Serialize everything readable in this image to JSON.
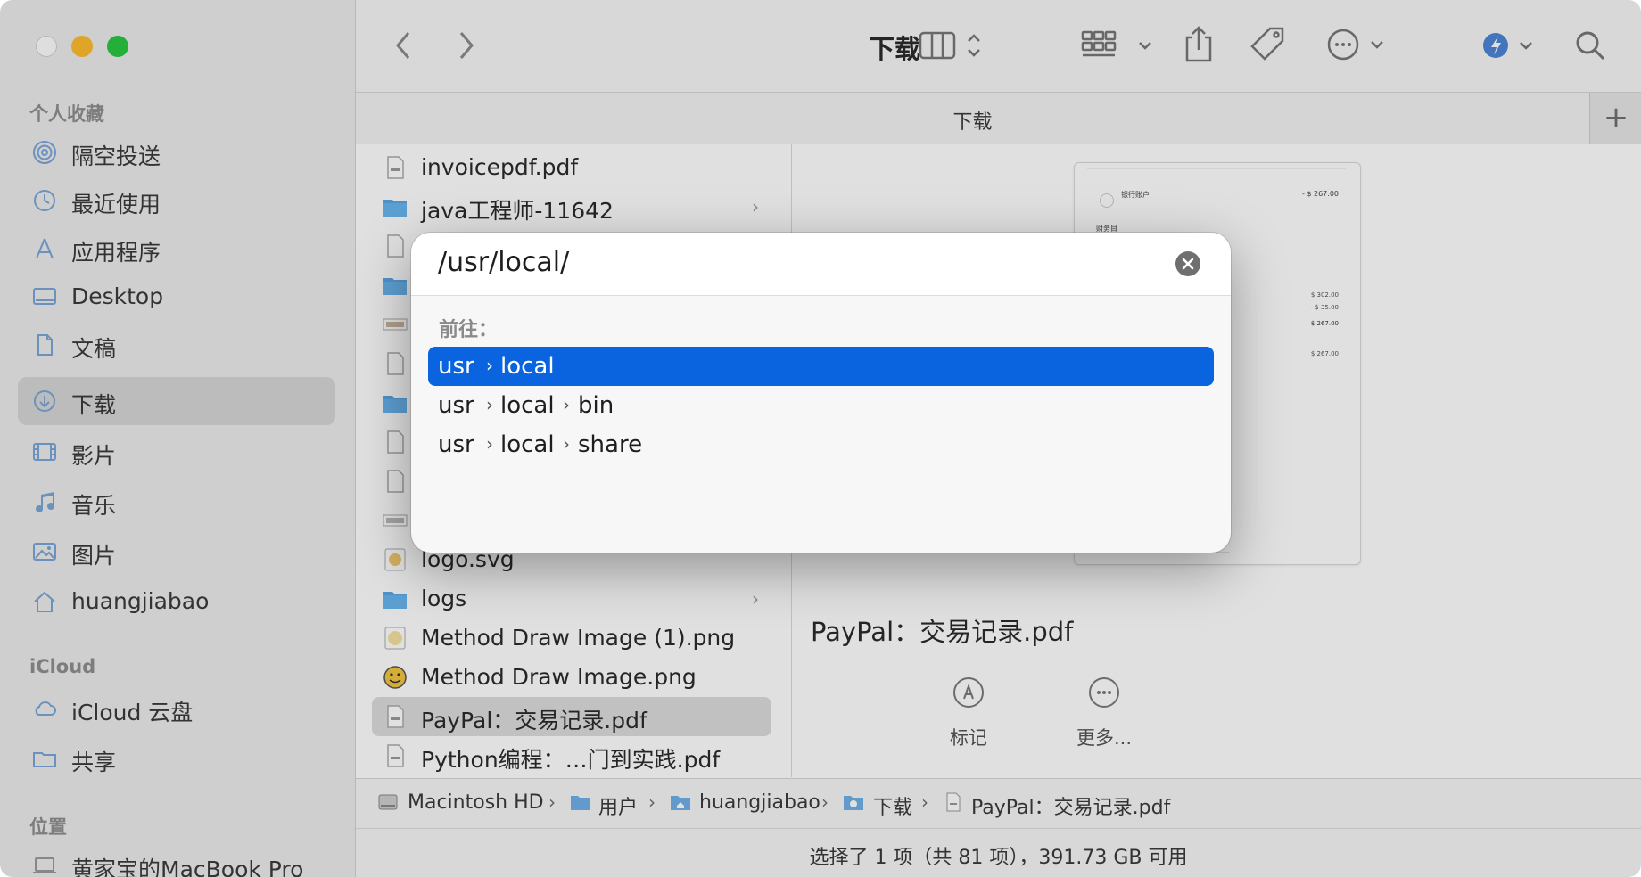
{
  "window": {
    "title": "下载",
    "tab_label": "下载",
    "tab_add": "+"
  },
  "sidebar": {
    "sections": [
      {
        "heading": "个人收藏"
      },
      {
        "heading": "iCloud"
      },
      {
        "heading": "位置"
      }
    ],
    "favorites": [
      {
        "label": "隔空投送",
        "icon": "airdrop-icon"
      },
      {
        "label": "最近使用",
        "icon": "clock-icon"
      },
      {
        "label": "应用程序",
        "icon": "apps-icon"
      },
      {
        "label": "Desktop",
        "icon": "desktop-icon"
      },
      {
        "label": "文稿",
        "icon": "document-icon"
      },
      {
        "label": "下载",
        "icon": "download-icon",
        "selected": true
      },
      {
        "label": "影片",
        "icon": "film-icon"
      },
      {
        "label": "音乐",
        "icon": "music-icon"
      },
      {
        "label": "图片",
        "icon": "photo-icon"
      },
      {
        "label": "huangjiabao",
        "icon": "home-icon"
      }
    ],
    "icloud": [
      {
        "label": "iCloud 云盘",
        "icon": "cloud-icon"
      },
      {
        "label": "共享",
        "icon": "shared-folder-icon"
      }
    ],
    "locations": [
      {
        "label": "黄家宝的MacBook Pro",
        "icon": "laptop-icon"
      }
    ]
  },
  "files": [
    {
      "name": "invoicepdf.pdf",
      "kind": "pdf"
    },
    {
      "name": "java工程师-11642",
      "kind": "folder",
      "has_children": true
    },
    {
      "name": "logo.svg",
      "kind": "svg"
    },
    {
      "name": "logs",
      "kind": "folder",
      "has_children": true
    },
    {
      "name": "Method Draw Image (1).png",
      "kind": "png"
    },
    {
      "name": "Method Draw Image.png",
      "kind": "png"
    },
    {
      "name": "PayPal：交易记录.pdf",
      "kind": "pdf",
      "selected": true
    },
    {
      "name": "Python编程：…门到实践.pdf",
      "kind": "pdf"
    }
  ],
  "preview": {
    "filename": "PayPal：交易记录.pdf",
    "actions": [
      {
        "label": "标记",
        "icon": "markup-icon"
      },
      {
        "label": "更多...",
        "icon": "more-icon"
      }
    ],
    "thumb_text": {
      "account": "银行账户",
      "amount_top": "- $ 267.00",
      "section": "财务目",
      "v1": "$ 302.00",
      "v2": "- $ 35.00",
      "v3": "$ 267.00",
      "v4": "$ 267.00"
    }
  },
  "pathbar": {
    "crumbs": [
      {
        "label": "Macintosh HD",
        "icon": "disk-icon"
      },
      {
        "label": "用户",
        "icon": "folder-icon"
      },
      {
        "label": "huangjiabao",
        "icon": "home-folder-icon"
      },
      {
        "label": "下载",
        "icon": "download-folder-icon"
      },
      {
        "label": "PayPal：交易记录.pdf",
        "icon": "pdf-file-icon"
      }
    ]
  },
  "status": {
    "text": "选择了 1 项（共 81 项），391.73 GB 可用"
  },
  "goto_dialog": {
    "input_value": "/usr/local/",
    "heading": "前往：",
    "suggestions": [
      {
        "segments": [
          "usr",
          "local"
        ],
        "selected": true
      },
      {
        "segments": [
          "usr",
          "local",
          "bin"
        ]
      },
      {
        "segments": [
          "usr",
          "local",
          "share"
        ]
      }
    ]
  },
  "colors": {
    "accent": "#0a63df",
    "sidebar_bg": "#ececec",
    "traffic_close": "#fdfdfd",
    "traffic_min": "#febc2e",
    "traffic_max": "#28c840"
  }
}
